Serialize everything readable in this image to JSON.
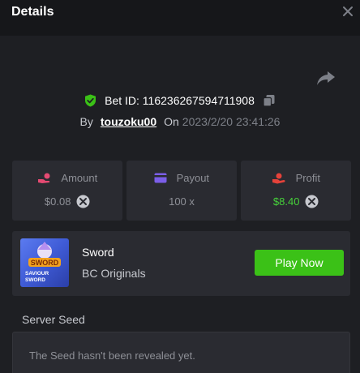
{
  "header": {
    "title": "Details"
  },
  "bet": {
    "id_label": "Bet ID:",
    "id_value": "116236267594711908",
    "by_label": "By",
    "username": "touzoku00",
    "on_label": "On",
    "timestamp": "2023/2/20 23:41:26"
  },
  "stats": [
    {
      "label": "Amount",
      "value": "$0.08",
      "icon": "amount-hand-icon",
      "color": "#e54a72"
    },
    {
      "label": "Payout",
      "value": "100 x",
      "icon": "payout-card-icon",
      "color": "#7b5ee8"
    },
    {
      "label": "Profit",
      "value": "$8.40",
      "icon": "profit-hand-icon",
      "color": "#e5423a"
    }
  ],
  "game": {
    "name": "Sword",
    "provider": "BC Originals",
    "play_label": "Play Now",
    "thumbnail_text": "SAVIOUR SWORD",
    "thumbnail_logo": "SWORD"
  },
  "seed": {
    "label": "Server Seed",
    "message": "The Seed hasn't been revealed yet."
  },
  "colors": {
    "background": "#1e1f23",
    "header": "#16171a",
    "panel": "#2a2b31",
    "accent_green": "#3bc117",
    "profit_green": "#46d13a"
  }
}
